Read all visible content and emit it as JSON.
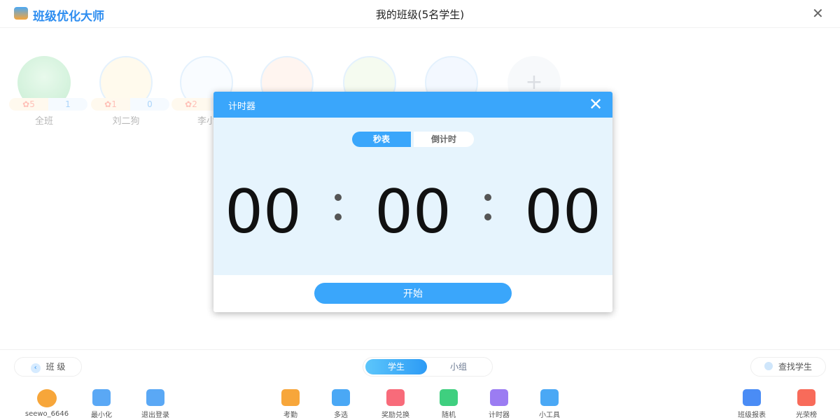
{
  "header": {
    "app_title": "班级优化大师",
    "page_title": "我的班级(5名学生)"
  },
  "students": [
    {
      "name": "全班",
      "stars": "✿5",
      "score": "1",
      "avatar": "sprout-icon"
    },
    {
      "name": "刘二狗",
      "stars": "✿1",
      "score": "0",
      "avatar": "tiger-avatar"
    },
    {
      "name": "李小",
      "stars": "✿2",
      "score": "",
      "avatar": "panda-avatar"
    },
    {
      "name": "",
      "stars": "",
      "score": "",
      "avatar": "fox-avatar"
    },
    {
      "name": "",
      "stars": "",
      "score": "",
      "avatar": "frog-avatar"
    },
    {
      "name": "",
      "stars": "",
      "score": "",
      "avatar": "cat-avatar"
    }
  ],
  "add_label": "+",
  "timer": {
    "title": "计时器",
    "tabs": [
      "秒表",
      "倒计时"
    ],
    "active_tab": "秒表",
    "hours": "00",
    "minutes": "00",
    "seconds": "00",
    "start_label": "开始"
  },
  "bottom": {
    "class_button": "班 级",
    "view_tabs": [
      "学生",
      "小组"
    ],
    "active_view": "学生",
    "search_label": "查找学生"
  },
  "toolbar": [
    {
      "label": "seewo_6646",
      "icon": "user-avatar",
      "color": "#f7a63a"
    },
    {
      "label": "最小化",
      "icon": "minimize-icon",
      "color": "#5aa8f5"
    },
    {
      "label": "退出登录",
      "icon": "logout-icon",
      "color": "#5aa8f5"
    },
    {
      "label": "考勤",
      "icon": "attendance-icon",
      "color": "#f7a63a"
    },
    {
      "label": "多选",
      "icon": "multiselect-icon",
      "color": "#4aa8f5"
    },
    {
      "label": "奖励兑换",
      "icon": "gift-icon",
      "color": "#f86b7a"
    },
    {
      "label": "随机",
      "icon": "random-icon",
      "color": "#3fcf7f"
    },
    {
      "label": "计时器",
      "icon": "timer-icon",
      "color": "#9b7cf2"
    },
    {
      "label": "小工具",
      "icon": "tools-icon",
      "color": "#4aa8f5"
    },
    {
      "label": "班级报表",
      "icon": "report-icon",
      "color": "#4a8cf5"
    },
    {
      "label": "光荣榜",
      "icon": "honor-icon",
      "color": "#f86b5a"
    }
  ],
  "colors": {
    "accent": "#3aa6fb",
    "timer_bg": "#e6f4fd"
  }
}
